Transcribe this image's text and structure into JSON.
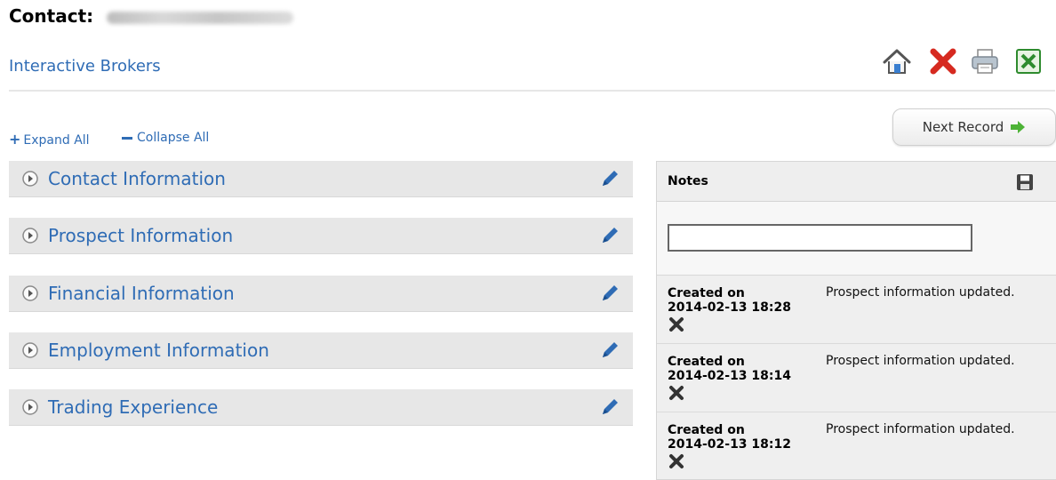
{
  "header": {
    "title_label": "Contact:",
    "company": "Interactive Brokers"
  },
  "toolbar": {
    "icons": [
      "home-icon",
      "delete-icon",
      "print-icon",
      "excel-export-icon"
    ],
    "colors": {
      "delete": "#d62a20",
      "excel": "#2e8b2e",
      "link": "#2f6cb5"
    }
  },
  "controls": {
    "expand_all": "Expand All",
    "collapse_all": "Collapse All",
    "next_record": "Next Record"
  },
  "sections": [
    {
      "label": "Contact Information"
    },
    {
      "label": "Prospect Information"
    },
    {
      "label": "Financial Information"
    },
    {
      "label": "Employment Information"
    },
    {
      "label": "Trading Experience"
    }
  ],
  "notes": {
    "title": "Notes",
    "input_value": "",
    "items": [
      {
        "created_label": "Created on",
        "timestamp": "2014-02-13 18:28",
        "text": "Prospect information updated."
      },
      {
        "created_label": "Created on",
        "timestamp": "2014-02-13 18:14",
        "text": "Prospect information updated."
      },
      {
        "created_label": "Created on",
        "timestamp": "2014-02-13 18:12",
        "text": "Prospect information updated."
      }
    ]
  }
}
